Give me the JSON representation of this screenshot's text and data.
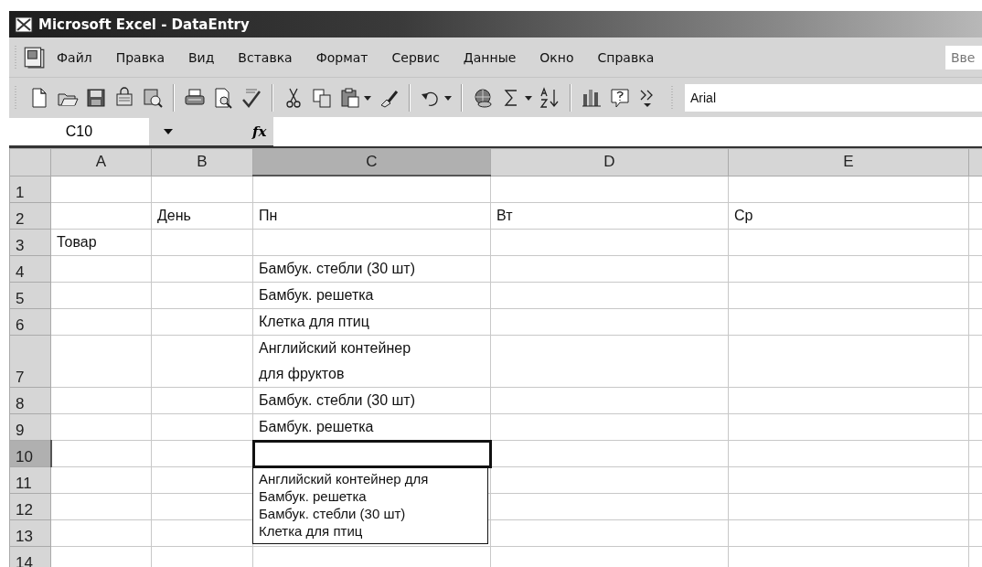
{
  "window": {
    "title": "Microsoft Excel - DataEntry"
  },
  "menu": {
    "items": [
      {
        "label": "Файл"
      },
      {
        "label": "Правка"
      },
      {
        "label": "Вид"
      },
      {
        "label": "Вставка"
      },
      {
        "label": "Формат"
      },
      {
        "label": "Сервис"
      },
      {
        "label": "Данные"
      },
      {
        "label": "Окно"
      },
      {
        "label": "Справка"
      }
    ],
    "help_search": {
      "placeholder": "Вве"
    }
  },
  "toolbar": {
    "font": "Arial"
  },
  "formula_bar": {
    "name_box": "C10",
    "function_label": "fx"
  },
  "sheet": {
    "columns": [
      {
        "label": "A",
        "selected": false
      },
      {
        "label": "B",
        "selected": false
      },
      {
        "label": "C",
        "selected": true
      },
      {
        "label": "D",
        "selected": false
      },
      {
        "label": "E",
        "selected": false
      }
    ],
    "rows": [
      {
        "label": "1",
        "selected": false,
        "cells": [
          null,
          null,
          null,
          null,
          null
        ]
      },
      {
        "label": "2",
        "selected": false,
        "cells": [
          null,
          "День",
          "Пн",
          "Вт",
          "Ср"
        ]
      },
      {
        "label": "3",
        "selected": false,
        "cells": [
          "Товар",
          null,
          null,
          null,
          null
        ]
      },
      {
        "label": "4",
        "selected": false,
        "cells": [
          null,
          null,
          "Бамбук. стебли (30 шт)",
          null,
          null
        ]
      },
      {
        "label": "5",
        "selected": false,
        "cells": [
          null,
          null,
          "Бамбук. решетка",
          null,
          null
        ]
      },
      {
        "label": "6",
        "selected": false,
        "cells": [
          null,
          null,
          "Клетка для птиц",
          null,
          null
        ]
      },
      {
        "label": "7",
        "selected": false,
        "cells": [
          null,
          null,
          "Английский контейнер\nдля фруктов",
          null,
          null
        ]
      },
      {
        "label": "8",
        "selected": false,
        "cells": [
          null,
          null,
          "Бамбук. стебли (30 шт)",
          null,
          null
        ]
      },
      {
        "label": "9",
        "selected": false,
        "cells": [
          null,
          null,
          "Бамбук. решетка",
          null,
          null
        ]
      },
      {
        "label": "10",
        "selected": true,
        "cells": [
          null,
          null,
          null,
          null,
          null
        ]
      },
      {
        "label": "11",
        "selected": false,
        "cells": [
          null,
          null,
          null,
          null,
          null
        ]
      },
      {
        "label": "12",
        "selected": false,
        "cells": [
          null,
          null,
          null,
          null,
          null
        ]
      },
      {
        "label": "13",
        "selected": false,
        "cells": [
          null,
          null,
          null,
          null,
          null
        ]
      },
      {
        "label": "14",
        "selected": false,
        "cells": [
          null,
          null,
          null,
          null,
          null
        ]
      }
    ],
    "autocomplete": {
      "items": [
        {
          "label": "Английский контейнер для"
        },
        {
          "label": "Бамбук. решетка"
        },
        {
          "label": "Бамбук. стебли (30 шт)"
        },
        {
          "label": "Клетка для птиц"
        }
      ]
    }
  }
}
